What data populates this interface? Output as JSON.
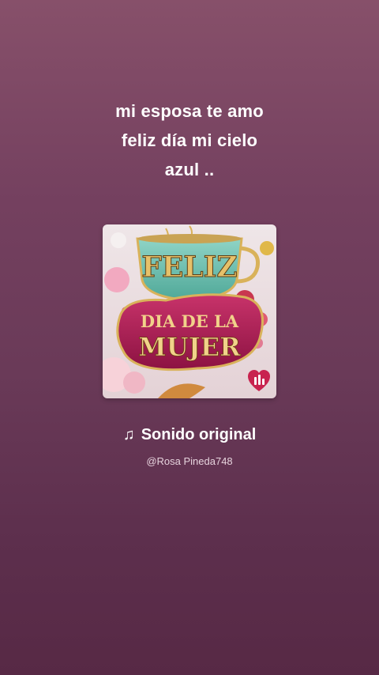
{
  "caption": "mi esposa te amo\nfeliz día mi cielo\nazul ..",
  "cover": {
    "line1": "FELIZ",
    "line2": "DIA DE LA",
    "line3": "MUJER",
    "badge_icon": "music-bars-icon"
  },
  "sound": {
    "icon": "music-note-icon",
    "note_glyph": "♫",
    "title": "Sonido original",
    "author": "@Rosa Pineda748"
  },
  "colors": {
    "background_top": "#87506a",
    "background_bottom": "#572945",
    "cup_teal": "#6fc3b5",
    "plaque_magenta": "#b01e55",
    "gold": "#d9b25a"
  }
}
